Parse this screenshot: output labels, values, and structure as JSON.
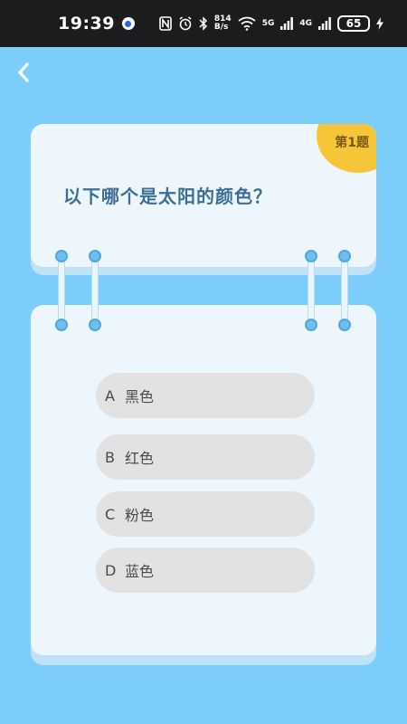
{
  "status_bar": {
    "time": "19:39",
    "speed_value": "814",
    "speed_unit": "B/s",
    "net_5g": "5G",
    "net_4g": "4G",
    "battery": "65"
  },
  "question": {
    "badge": "第1题",
    "text": "以下哪个是太阳的颜色？"
  },
  "options": [
    {
      "letter": "A",
      "text": "黑色"
    },
    {
      "letter": "B",
      "text": "红色"
    },
    {
      "letter": "C",
      "text": "粉色"
    },
    {
      "letter": "D",
      "text": "蓝色"
    }
  ]
}
